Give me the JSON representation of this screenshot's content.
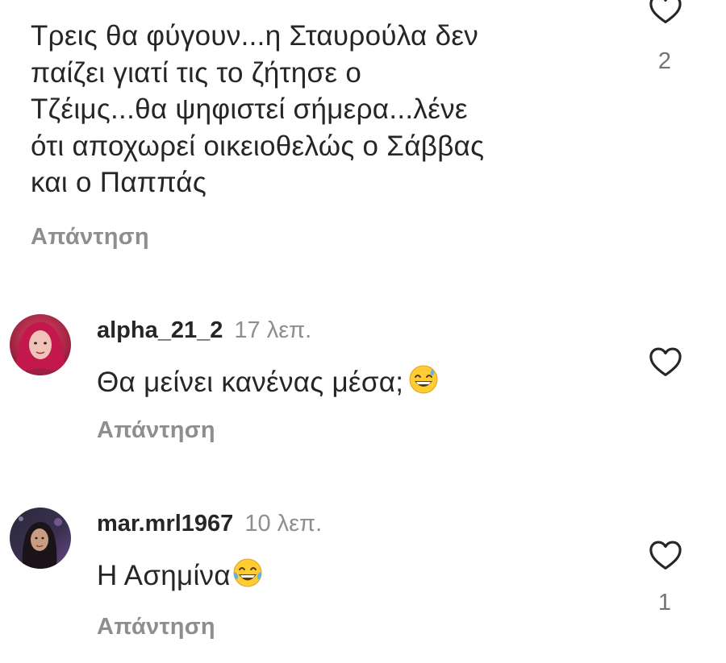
{
  "comments": [
    {
      "text": "Τρεις θα φύγουν...η Σταυρούλα δεν\nπαίζει γιατί τις το ζήτησε ο\nΤζέιμς...θα ψηφιστεί σήμερα...λένε\nότι αποχωρεί οικειοθελώς ο Σάββας\nκαι ο Παππάς",
      "reply_label": "Απάντηση",
      "likes": "2",
      "like_icon": "heart-outline-icon"
    },
    {
      "username": "alpha_21_2",
      "time": "17 λεπ.",
      "text": "Θα μείνει κανένας μέσα;",
      "emoji": "grinning-face-with-sweat-emoji",
      "reply_label": "Απάντηση",
      "like_icon": "heart-outline-icon"
    },
    {
      "username": "mar.mrl1967",
      "time": "10 λεπ.",
      "text": "Η Ασημίνα",
      "emoji": "face-with-tears-of-joy-emoji",
      "reply_label": "Απάντηση",
      "likes": "1",
      "like_icon": "heart-outline-icon"
    }
  ],
  "colors": {
    "text": "#262626",
    "muted": "#8e8e8e",
    "background": "#ffffff"
  }
}
